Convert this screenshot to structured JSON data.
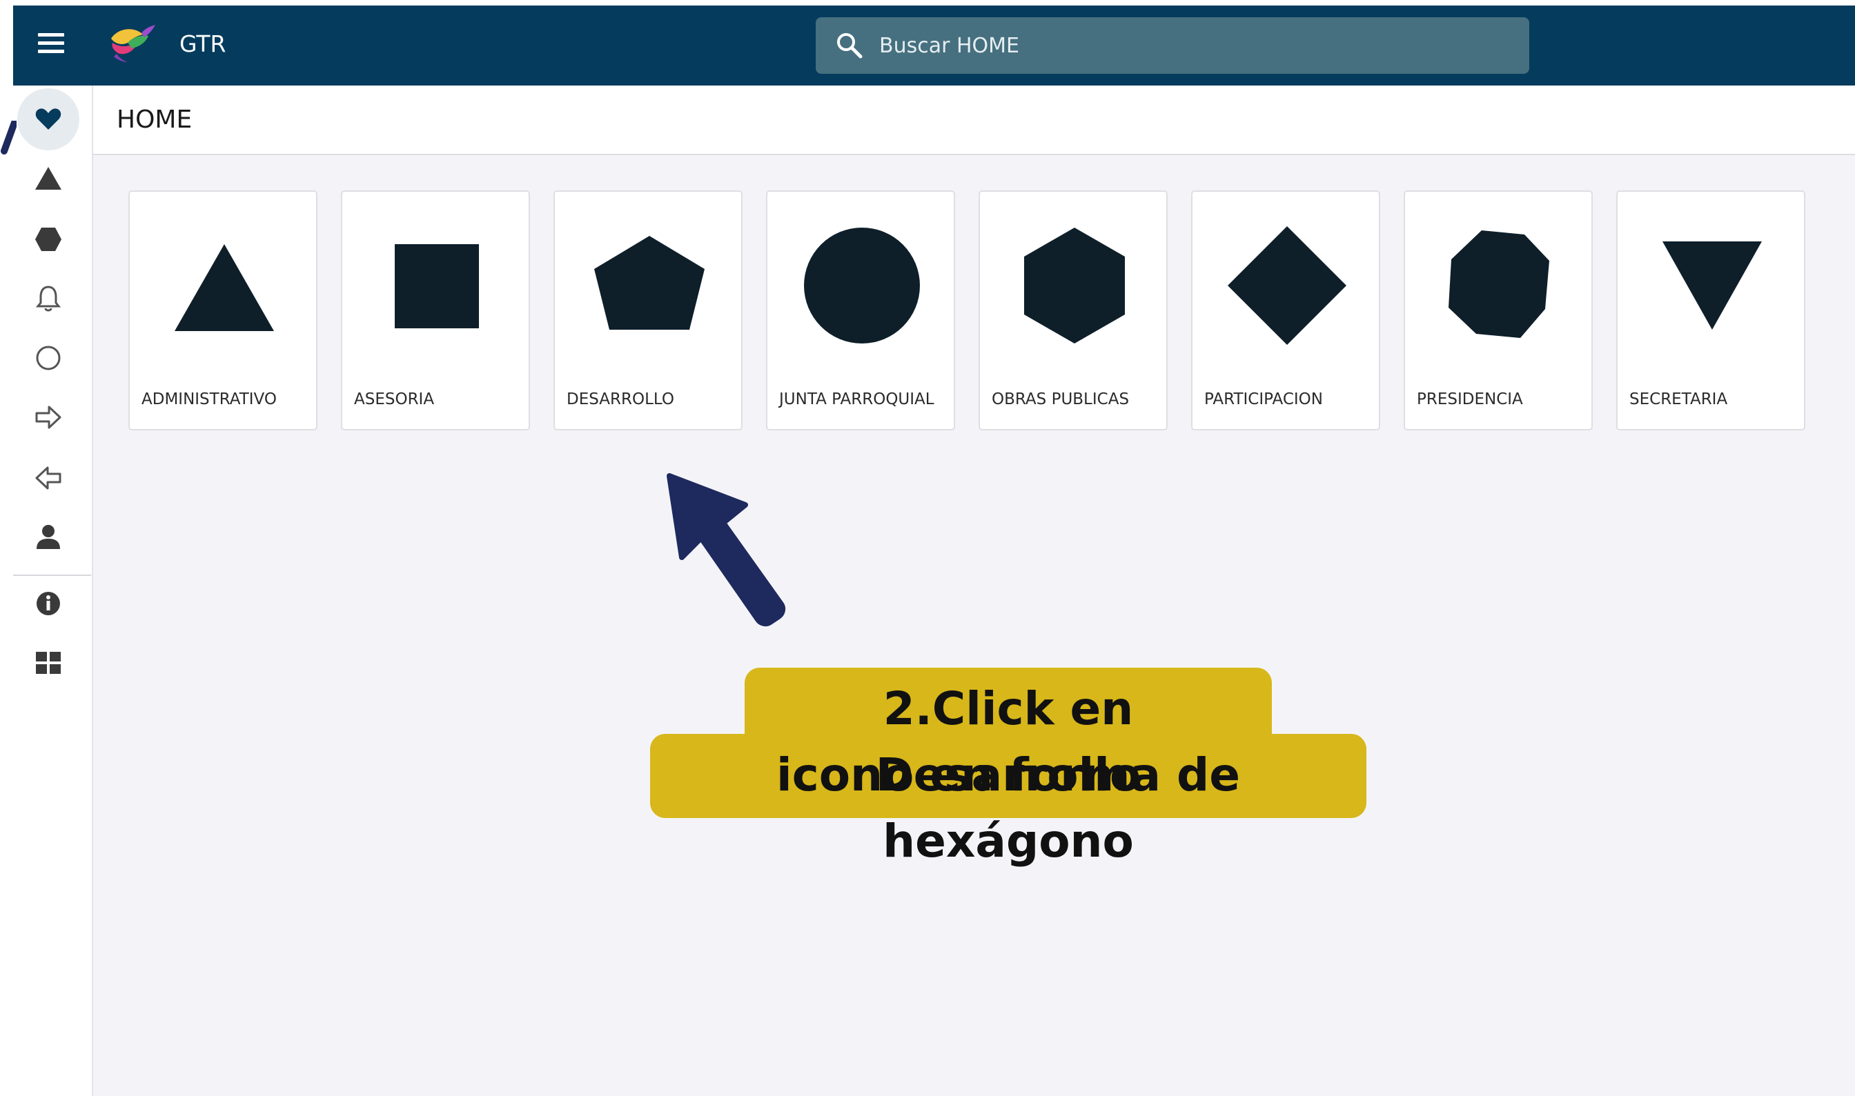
{
  "app": {
    "title": "GTR",
    "brand_color": "#053B5C",
    "logo": "hummingbird-logo"
  },
  "search": {
    "placeholder": "Buscar HOME",
    "value": "",
    "icon": "search-icon"
  },
  "sidebar": {
    "items": [
      {
        "icon": "heart-icon",
        "active": true
      },
      {
        "icon": "triangle-icon"
      },
      {
        "icon": "hexagon-icon"
      },
      {
        "icon": "bell-icon"
      },
      {
        "icon": "circle-icon"
      },
      {
        "icon": "arrow-right-outline-icon"
      },
      {
        "icon": "arrow-left-outline-icon"
      },
      {
        "icon": "user-icon"
      },
      {
        "icon": "info-icon"
      },
      {
        "icon": "grid-icon"
      }
    ]
  },
  "page": {
    "title": "HOME"
  },
  "cards": [
    {
      "label": "ADMINISTRATIVO",
      "icon": "triangle-icon"
    },
    {
      "label": "ASESORIA",
      "icon": "square-icon"
    },
    {
      "label": "DESARROLLO",
      "icon": "pentagon-icon"
    },
    {
      "label": "JUNTA PARROQUIAL",
      "icon": "circle-icon"
    },
    {
      "label": "OBRAS PUBLICAS",
      "icon": "hexagon-icon"
    },
    {
      "label": "PARTICIPACION",
      "icon": "diamond-icon"
    },
    {
      "label": "PRESIDENCIA",
      "icon": "octagon-icon"
    },
    {
      "label": "SECRETARIA",
      "icon": "inverted-triangle-icon"
    }
  ],
  "annotation": {
    "line1": "2.Click en Desarrollo",
    "line2": "icono en forma de hexágono",
    "color": "#D7B71A",
    "arrow_color": "#1E2A5E"
  }
}
